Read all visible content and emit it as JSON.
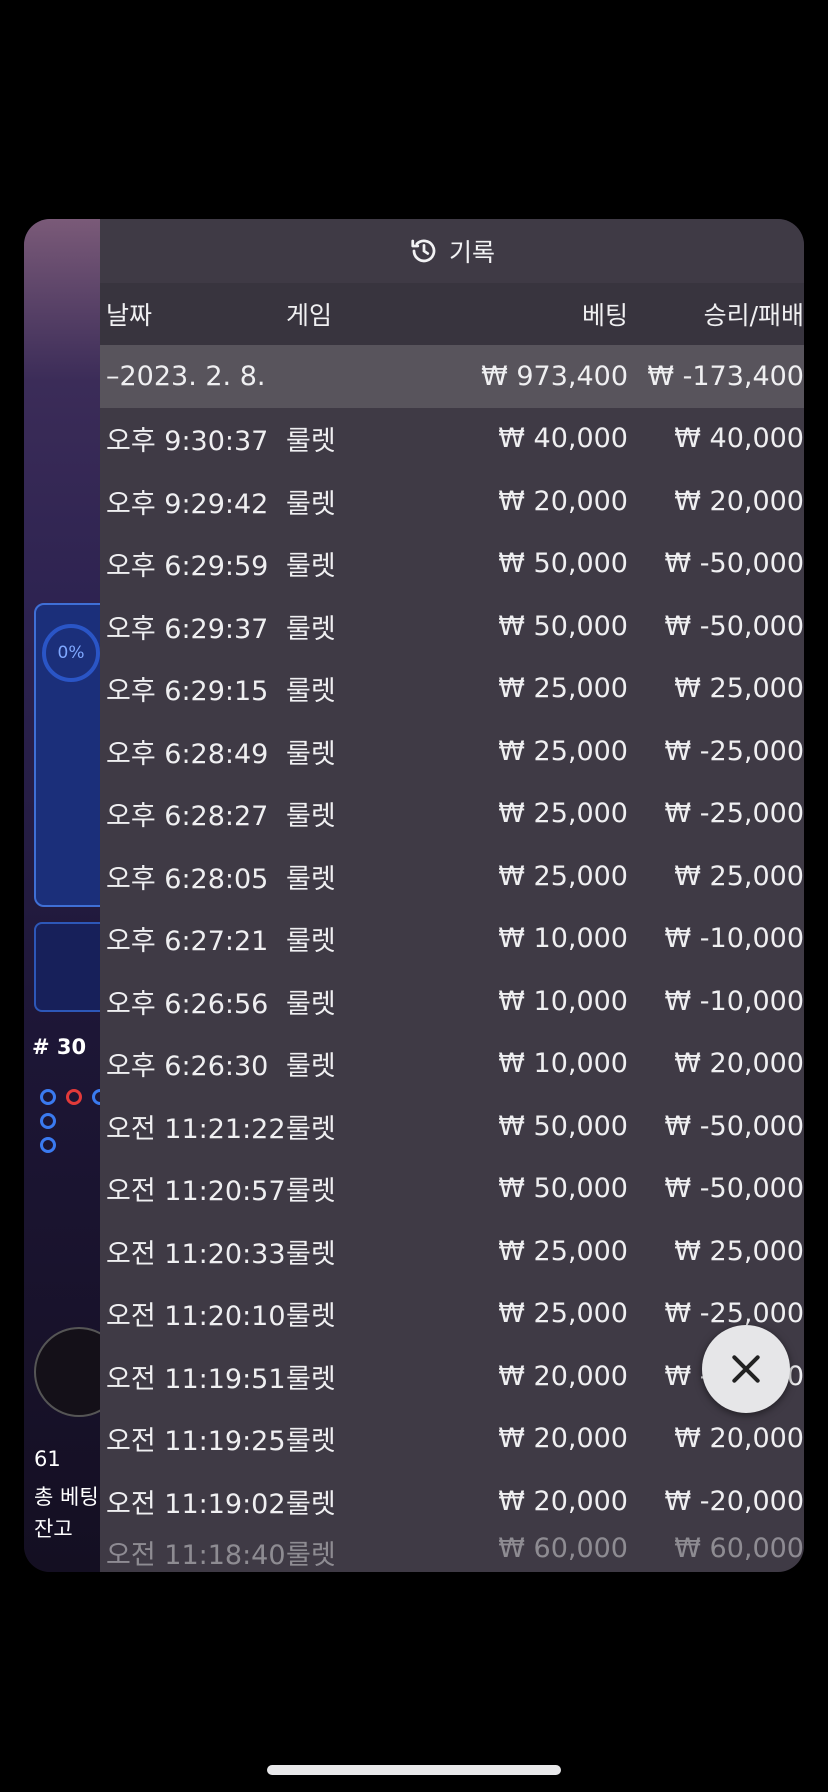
{
  "panel": {
    "title": "기록",
    "columns": {
      "date": "날짜",
      "game": "게임",
      "bet": "베팅",
      "result": "승리/패배"
    },
    "date_row": {
      "date": "–2023. 2. 8.",
      "bet": "₩ 973,400",
      "result": "₩ -173,400"
    },
    "rows": [
      {
        "time": "오후 9:30:37",
        "game": "룰렛",
        "bet": "₩ 40,000",
        "result": "₩ 40,000"
      },
      {
        "time": "오후 9:29:42",
        "game": "룰렛",
        "bet": "₩ 20,000",
        "result": "₩ 20,000"
      },
      {
        "time": "오후 6:29:59",
        "game": "룰렛",
        "bet": "₩ 50,000",
        "result": "₩ -50,000"
      },
      {
        "time": "오후 6:29:37",
        "game": "룰렛",
        "bet": "₩ 50,000",
        "result": "₩ -50,000"
      },
      {
        "time": "오후 6:29:15",
        "game": "룰렛",
        "bet": "₩ 25,000",
        "result": "₩ 25,000"
      },
      {
        "time": "오후 6:28:49",
        "game": "룰렛",
        "bet": "₩ 25,000",
        "result": "₩ -25,000"
      },
      {
        "time": "오후 6:28:27",
        "game": "룰렛",
        "bet": "₩ 25,000",
        "result": "₩ -25,000"
      },
      {
        "time": "오후 6:28:05",
        "game": "룰렛",
        "bet": "₩ 25,000",
        "result": "₩ 25,000"
      },
      {
        "time": "오후 6:27:21",
        "game": "룰렛",
        "bet": "₩ 10,000",
        "result": "₩ -10,000"
      },
      {
        "time": "오후 6:26:56",
        "game": "룰렛",
        "bet": "₩ 10,000",
        "result": "₩ -10,000"
      },
      {
        "time": "오후 6:26:30",
        "game": "룰렛",
        "bet": "₩ 10,000",
        "result": "₩ 20,000"
      },
      {
        "time": "오전 11:21:22",
        "game": "룰렛",
        "bet": "₩ 50,000",
        "result": "₩ -50,000"
      },
      {
        "time": "오전 11:20:57",
        "game": "룰렛",
        "bet": "₩ 50,000",
        "result": "₩ -50,000"
      },
      {
        "time": "오전 11:20:33",
        "game": "룰렛",
        "bet": "₩ 25,000",
        "result": "₩ 25,000"
      },
      {
        "time": "오전 11:20:10",
        "game": "룰렛",
        "bet": "₩ 25,000",
        "result": "₩ -25,000"
      },
      {
        "time": "오전 11:19:51",
        "game": "룰렛",
        "bet": "₩ 20,000",
        "result": "₩ -20,000"
      },
      {
        "time": "오전 11:19:25",
        "game": "룰렛",
        "bet": "₩ 20,000",
        "result": "₩ 20,000"
      },
      {
        "time": "오전 11:19:02",
        "game": "룰렛",
        "bet": "₩ 20,000",
        "result": "₩ -20,000"
      },
      {
        "time": "오전 11:18:40",
        "game": "룰렛",
        "bet": "₩ 60,000",
        "result": "₩ 60,000"
      }
    ]
  },
  "background": {
    "progress": "0%",
    "round": "# 30",
    "players": "61",
    "total_bet_label": "총 베팅",
    "balance_label": "잔고"
  },
  "icons": {
    "history": "history-icon",
    "close": "close-icon"
  }
}
